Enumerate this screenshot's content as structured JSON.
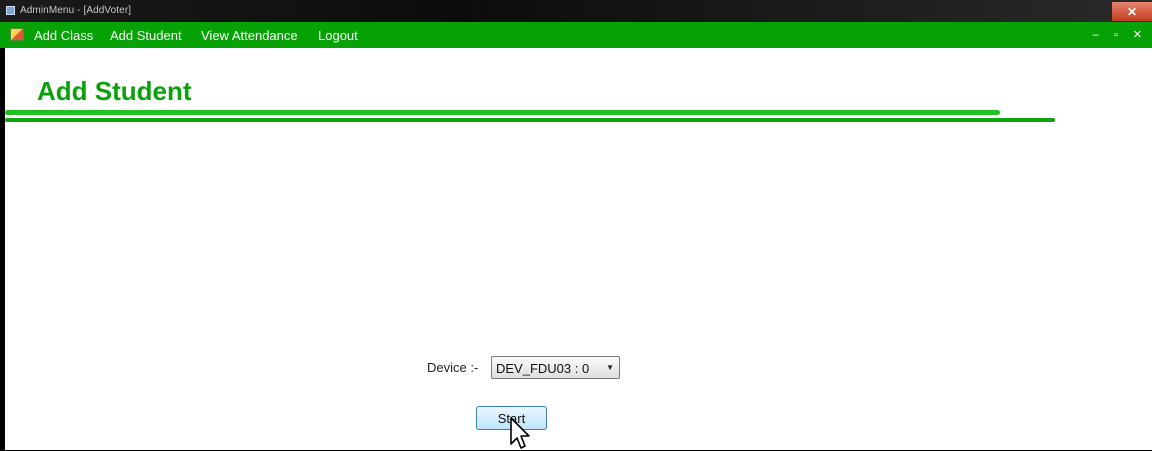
{
  "window": {
    "title": "AdminMenu - [AddVoter]",
    "close_glyph": "✕"
  },
  "menu": {
    "items": [
      {
        "label": "Add Class"
      },
      {
        "label": "Add Student"
      },
      {
        "label": "View Attendance"
      },
      {
        "label": "Logout"
      }
    ],
    "mdi_controls": "– ▫ ✕"
  },
  "page": {
    "title": "Add Student",
    "device_label": "Device :-",
    "device_value": "DEV_FDU03 : 0",
    "start_label": "Start"
  },
  "icons": {
    "app_icon": "window-app-icon",
    "menu_icon": "menu-app-icon",
    "dropdown": "chevron-down-icon",
    "cursor": "mouse-cursor-icon"
  },
  "colors": {
    "menubar": "#06a206",
    "title_green": "#0ba10b",
    "close_red": "#c23c22"
  }
}
